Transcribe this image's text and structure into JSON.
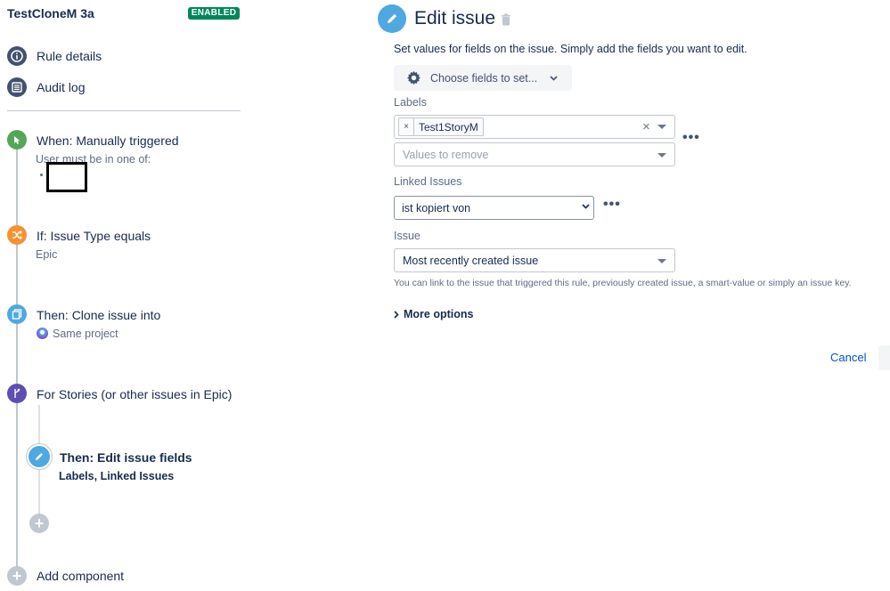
{
  "rule": {
    "title": "TestCloneM 3a",
    "status": "ENABLED"
  },
  "nav": [
    {
      "label": "Rule details",
      "icon": "info-icon"
    },
    {
      "label": "Audit log",
      "icon": "list-icon"
    }
  ],
  "timeline": {
    "trigger": {
      "title": "When: Manually triggered",
      "sub": "User must be in one of:"
    },
    "condition": {
      "title": "If: Issue Type equals",
      "sub": "Epic"
    },
    "clone": {
      "title": "Then: Clone issue into",
      "sub": "Same project"
    },
    "branch": {
      "title": "For Stories (or other issues in Epic)"
    },
    "edit": {
      "title": "Then: Edit issue fields",
      "sub_a": "Labels",
      "sub_sep": ", ",
      "sub_b": "Linked Issues"
    },
    "add_component": "Add component"
  },
  "panel": {
    "title": "Edit issue",
    "description": "Set values for fields on the issue. Simply add the fields you want to edit.",
    "choose_fields": "Choose fields to set...",
    "labels_label": "Labels",
    "label_tag": "Test1StoryM",
    "remove_placeholder": "Values to remove",
    "linked_label": "Linked Issues",
    "linked_value": "ist kopiert von",
    "issue_label": "Issue",
    "issue_value": "Most recently created issue",
    "help": "You can link to the issue that triggered this rule, previously created issue, a smart-value or simply an issue key.",
    "more_options": "More options",
    "cancel": "Cancel"
  },
  "colors": {
    "enabled_badge": "#00875a",
    "trigger": "#57a55a",
    "condition": "#f79232",
    "action": "#4fa8e0",
    "branch": "#5e4db2",
    "link": "#0052cc"
  }
}
